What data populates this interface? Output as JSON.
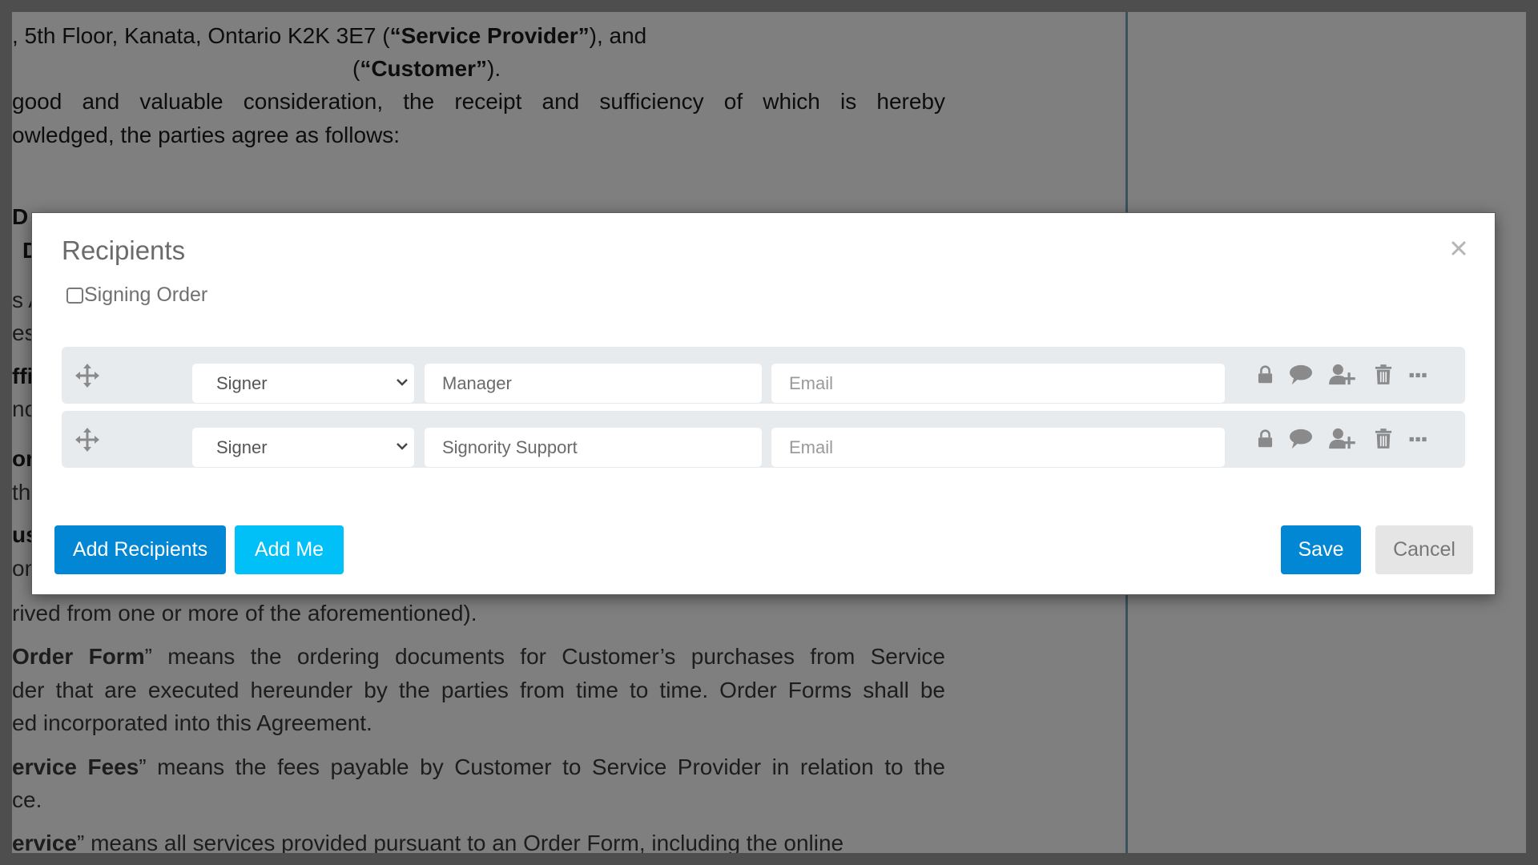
{
  "document": {
    "lines_top": [
      {
        "segments": [
          {
            "t": ", 5th Floor, Kanata, Ontario K2K 3E7 (",
            "b": false
          },
          {
            "t": "“Service Provider”",
            "b": true
          },
          {
            "t": "), and",
            "b": false
          }
        ]
      },
      {
        "segments": [
          {
            "t": "(",
            "b": false
          },
          {
            "t": "“Customer”",
            "b": true
          },
          {
            "t": ").",
            "b": false
          }
        ]
      },
      {
        "segments": [
          {
            "t": "good and valuable consideration, the receipt and sufficiency of which is hereby",
            "b": false
          }
        ]
      },
      {
        "segments": [
          {
            "t": "owledged, the parties agree as follows:",
            "b": false
          }
        ]
      }
    ],
    "left_fragments": [
      "D",
      "D",
      "s A",
      "esp",
      "ffi",
      "no",
      "or",
      "th",
      "us",
      "om"
    ],
    "lines_bottom": [
      {
        "segments": [
          {
            "t": "rived from one or more of the aforementioned).",
            "b": false
          }
        ]
      },
      {
        "segments": [
          {
            "t": "Order Form",
            "b": true
          },
          {
            "t": "” means the ordering documents for Customer’s purchases from Service",
            "b": false
          }
        ]
      },
      {
        "segments": [
          {
            "t": "der that are executed hereunder by the parties from time to time. Order Forms shall be",
            "b": false
          }
        ]
      },
      {
        "segments": [
          {
            "t": "ed incorporated into this Agreement.",
            "b": false
          }
        ]
      },
      {
        "segments": [
          {
            "t": "ervice Fees",
            "b": true
          },
          {
            "t": "” means the fees payable by Customer to Service Provider in relation to the",
            "b": false
          }
        ]
      },
      {
        "segments": [
          {
            "t": "ce.",
            "b": false
          }
        ]
      },
      {
        "segments": [
          {
            "t": "ervice",
            "b": true
          },
          {
            "t": "” means all services provided pursuant to an Order Form, including the online",
            "b": false
          }
        ]
      }
    ]
  },
  "modal": {
    "title": "Recipients",
    "close_icon": "close-icon",
    "signing_order": {
      "label": "Signing Order",
      "checked": false
    },
    "recipients": [
      {
        "role": "Signer",
        "name": "Manager",
        "email": "",
        "email_placeholder": "Email"
      },
      {
        "role": "Signer",
        "name": "Signority Support",
        "email": "",
        "email_placeholder": "Email"
      }
    ],
    "row_icons": [
      "drag-move-icon",
      "lock-icon",
      "comment-icon",
      "add-user-icon",
      "trash-icon",
      "more-icon"
    ],
    "buttons": {
      "add_recipients": "Add Recipients",
      "add_me": "Add Me",
      "save": "Save",
      "cancel": "Cancel"
    }
  },
  "colors": {
    "primary": "#0287d4",
    "secondary": "#00c0f7",
    "cancel_bg": "#e5e5e5",
    "row_bg": "#e8ebee",
    "icon": "#888888"
  }
}
